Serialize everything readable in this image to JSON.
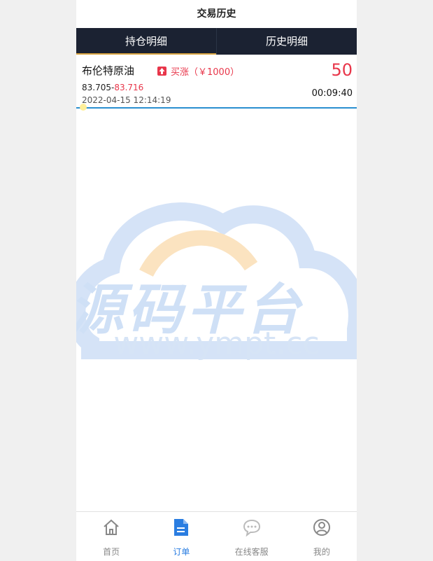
{
  "header": {
    "title": "交易历史"
  },
  "tabs": [
    {
      "label": "持仓明细"
    },
    {
      "label": "历史明细"
    }
  ],
  "order": {
    "product": "布伦特原油",
    "direction": "买涨（￥1000）",
    "amount": "50",
    "open_price": "83.705-",
    "close_price": "83.716",
    "date": "2022-04-15 12:14:19",
    "timer": "00:09:40"
  },
  "watermark": {
    "text": "源码平台",
    "url": "www.ympt.cc"
  },
  "tabbar": [
    {
      "label": "首页",
      "icon": "home-icon"
    },
    {
      "label": "订单",
      "icon": "document-icon"
    },
    {
      "label": "在线客服",
      "icon": "chat-icon"
    },
    {
      "label": "我的",
      "icon": "user-icon"
    }
  ],
  "colors": {
    "accent": "#2a7de1",
    "up": "#e8364a",
    "tabbar_bg": "#1b2232"
  }
}
